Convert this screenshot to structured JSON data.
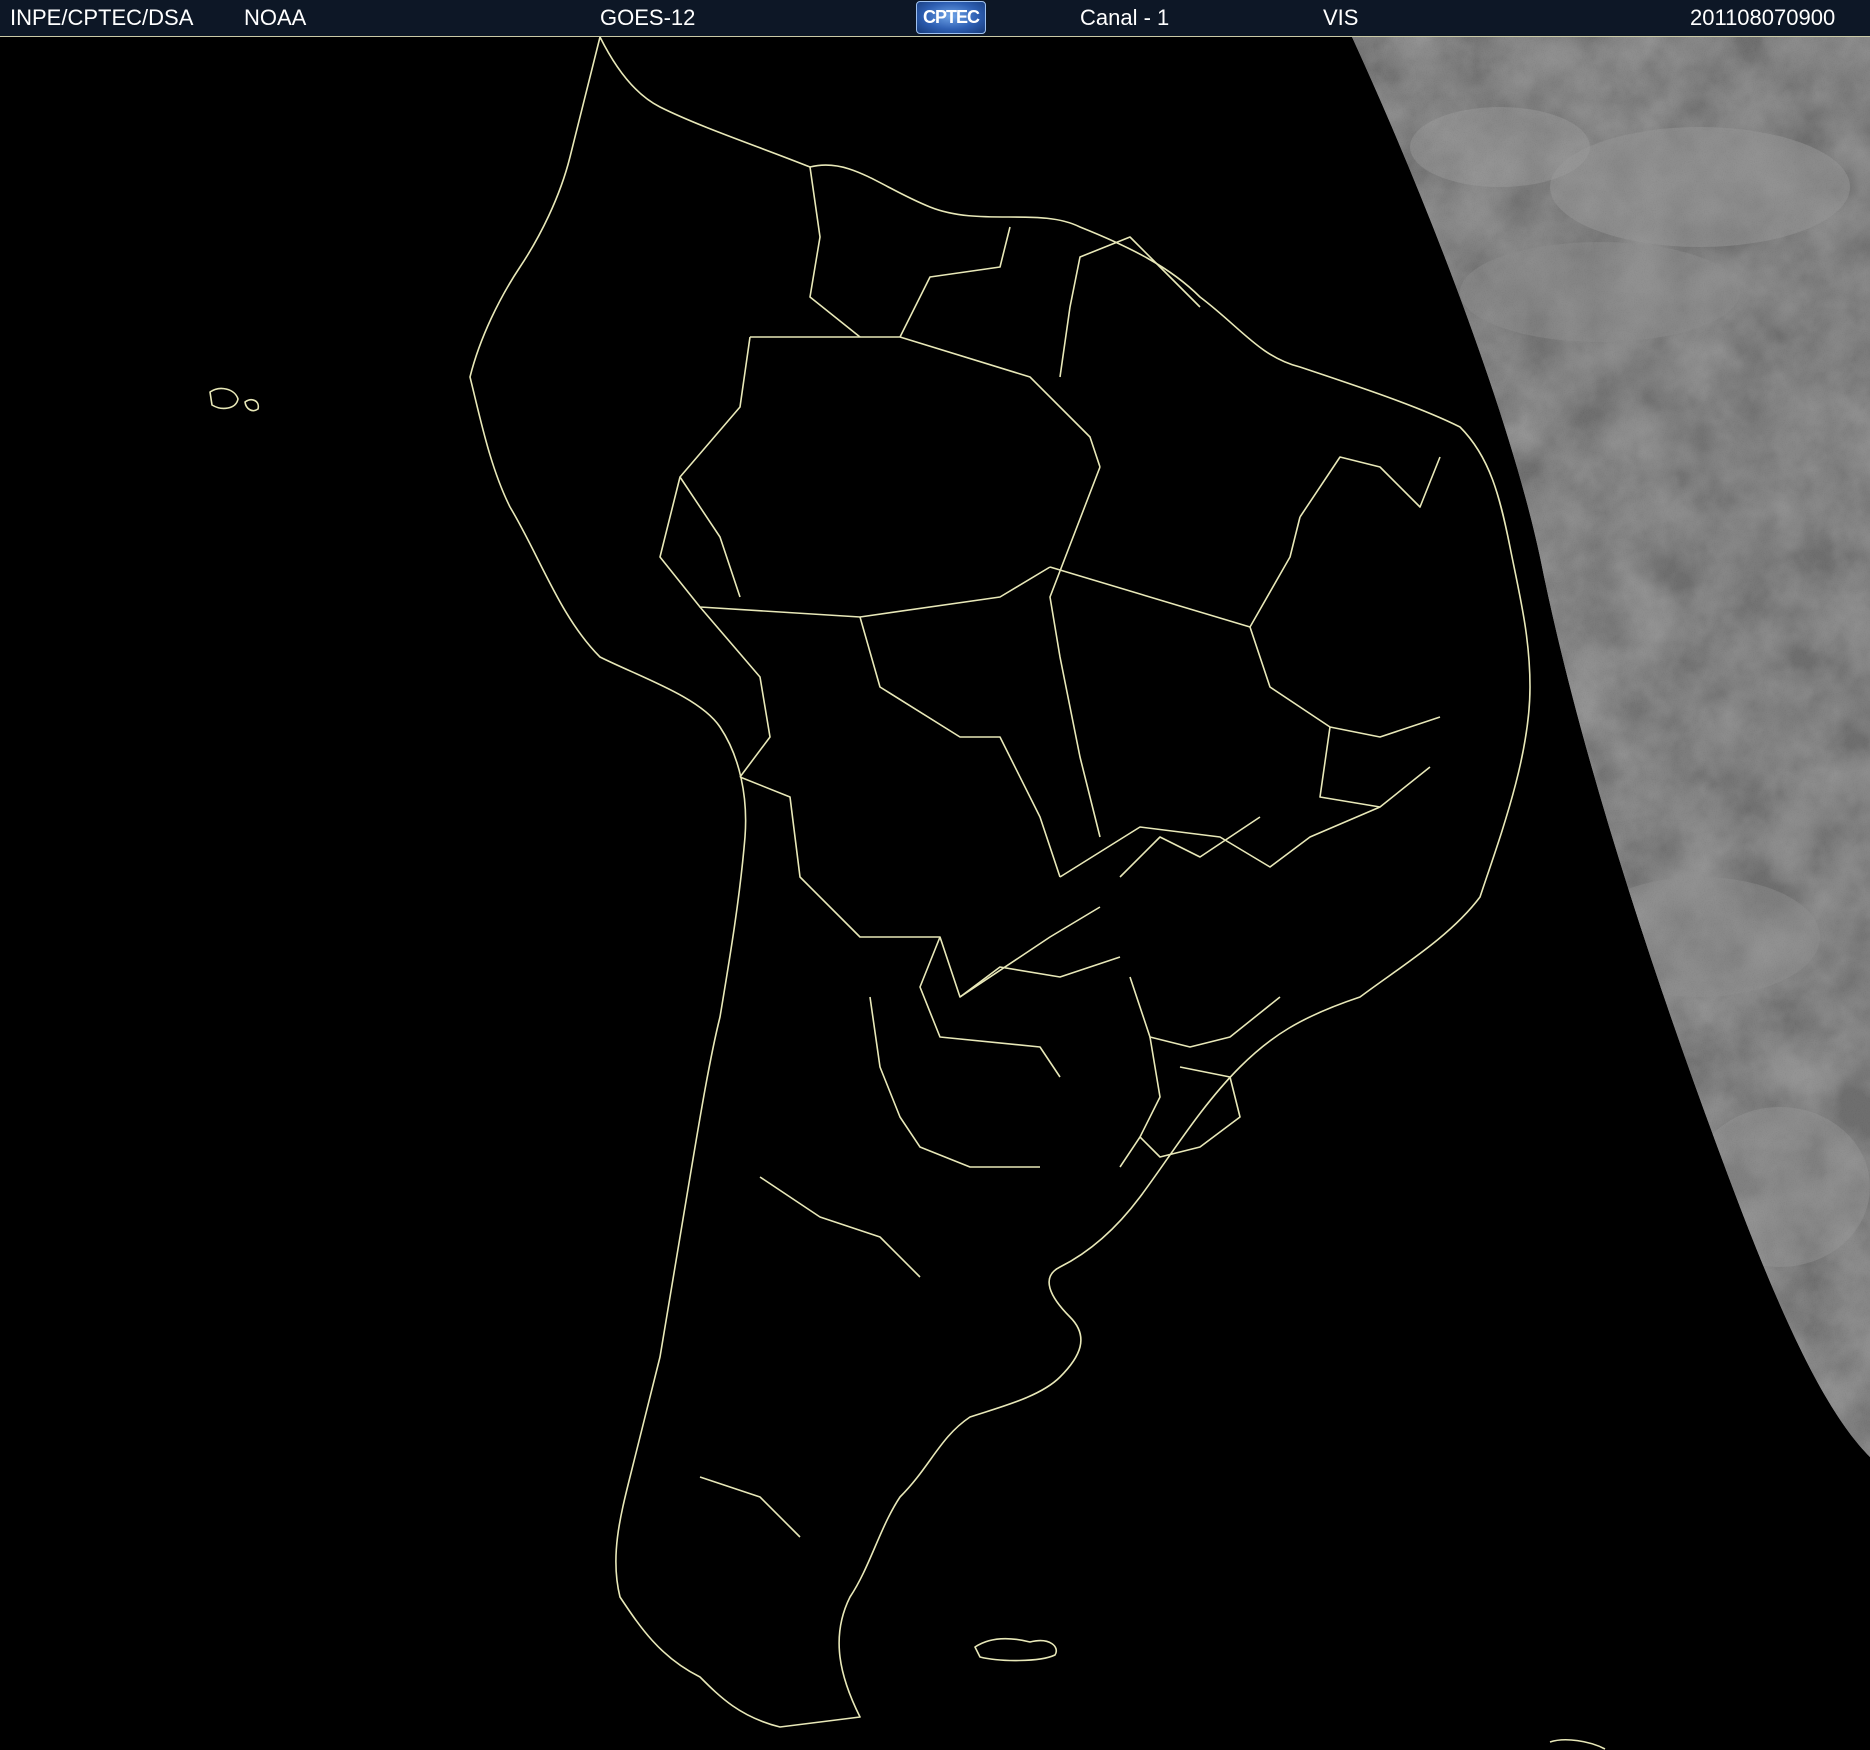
{
  "header": {
    "agency": "INPE/CPTEC/DSA",
    "source": "NOAA",
    "satellite": "GOES-12",
    "logo_text": "CPTEC",
    "channel": "Canal - 1",
    "band": "VIS",
    "timestamp": "201108070900"
  },
  "colors": {
    "header_bg": "#0d1726",
    "background": "#000000",
    "boundary_lines": "#e8e8b8",
    "cloud_grey": "#8a8a8a"
  }
}
